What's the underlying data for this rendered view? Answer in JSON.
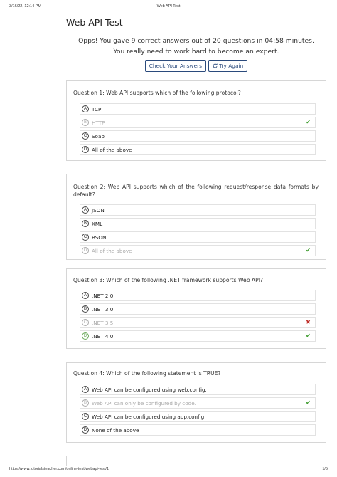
{
  "print_header": {
    "datetime": "3/16/22, 12:14 PM",
    "doc_title": "Web API Test"
  },
  "print_footer": {
    "url": "https://www.tutorialsteacher.com/online-test/webapi-test/1",
    "page": "1/5"
  },
  "page_title": "Web API Test",
  "result": {
    "line1": "Opps! You gave 9 correct answers out of 20 questions in 04:58 minutes.",
    "line2": "You really need to work hard to become an expert."
  },
  "actions": {
    "check_label": "Check Your Answers",
    "try_again_label": "Try Again",
    "try_again_icon": "refresh-icon"
  },
  "questions": [
    {
      "text": "Question 1: Web API supports which of the following protocol?",
      "options": [
        {
          "letter": "A",
          "text": "TCP",
          "state": "normal"
        },
        {
          "letter": "B",
          "text": "HTTP",
          "state": "correct"
        },
        {
          "letter": "C",
          "text": "Soap",
          "state": "normal"
        },
        {
          "letter": "D",
          "text": "All of the above",
          "state": "normal"
        }
      ]
    },
    {
      "text": "Question 2: Web API supports which of the following request/response data formats by default?",
      "options": [
        {
          "letter": "A",
          "text": "JSON",
          "state": "normal"
        },
        {
          "letter": "B",
          "text": "XML",
          "state": "normal"
        },
        {
          "letter": "C",
          "text": "BSON",
          "state": "normal"
        },
        {
          "letter": "D",
          "text": "All of the above",
          "state": "correct"
        }
      ]
    },
    {
      "text": "Question 3: Which of the following .NET framework supports Web API?",
      "options": [
        {
          "letter": "A",
          "text": ".NET 2.0",
          "state": "normal"
        },
        {
          "letter": "B",
          "text": ".NET 3.0",
          "state": "normal"
        },
        {
          "letter": "C",
          "text": ".NET 3.5",
          "state": "wrong"
        },
        {
          "letter": "D",
          "text": ".NET 4.0",
          "state": "correct-selected"
        }
      ]
    },
    {
      "text": "Question 4: Which of the following statement is TRUE?",
      "options": [
        {
          "letter": "A",
          "text": "Web API can be configured using web.config.",
          "state": "normal"
        },
        {
          "letter": "B",
          "text": "Web API can only be configured by code.",
          "state": "correct"
        },
        {
          "letter": "C",
          "text": "Web API can be configured using app.config.",
          "state": "normal"
        },
        {
          "letter": "D",
          "text": "None of the above",
          "state": "normal"
        }
      ]
    }
  ],
  "colors": {
    "correct": "#3a9a2a",
    "wrong": "#c0302a",
    "button_border": "#2a4a7c",
    "muted_text": "#a9a9a9"
  }
}
